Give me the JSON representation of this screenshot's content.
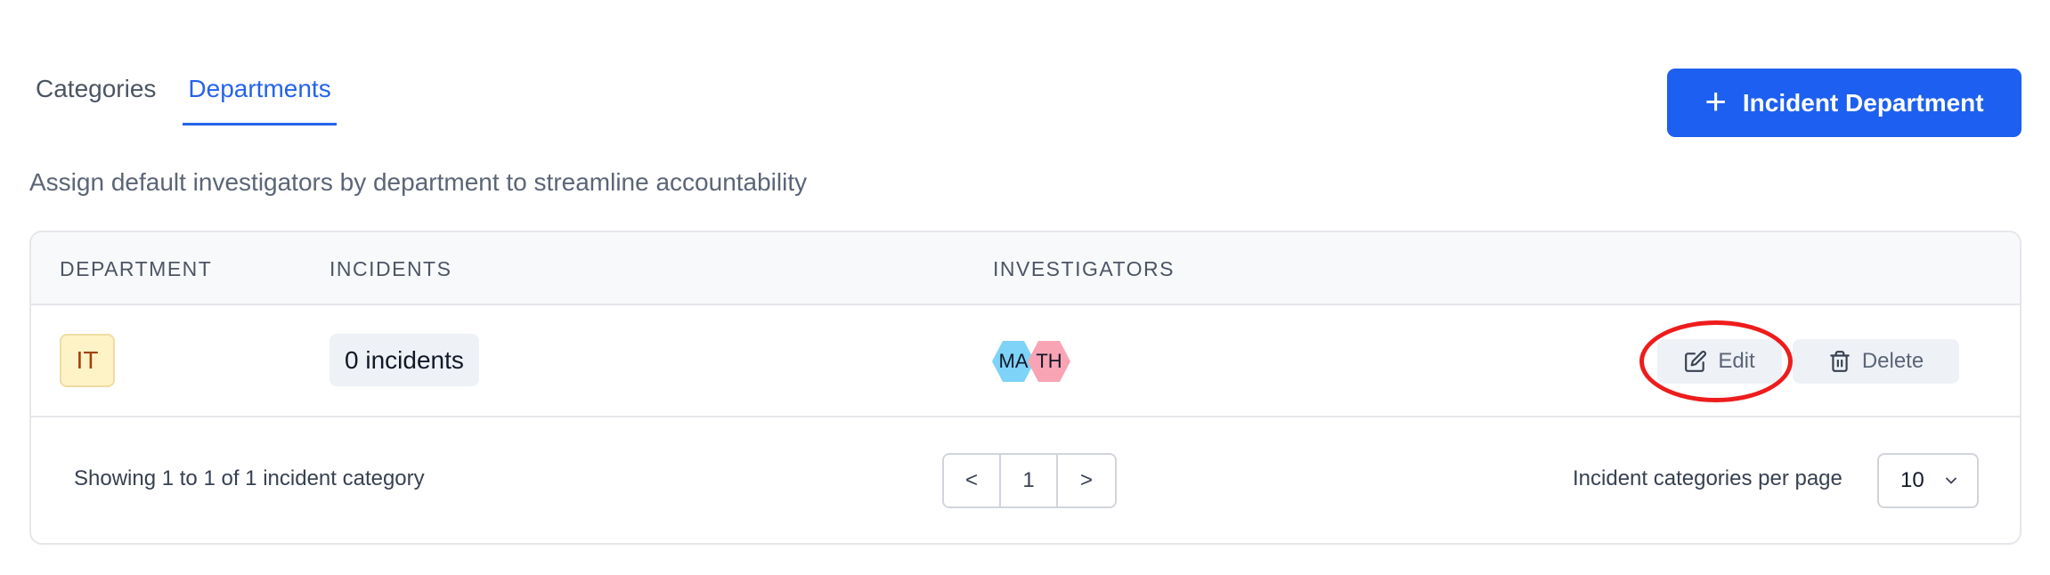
{
  "tabs": [
    {
      "label": "Categories",
      "active": false
    },
    {
      "label": "Departments",
      "active": true
    }
  ],
  "actions": {
    "add_department_label": "Incident Department",
    "add_icon": "plus-icon"
  },
  "subtitle": "Assign default investigators by department to streamline accountability",
  "table": {
    "columns": [
      "DEPARTMENT",
      "INCIDENTS",
      "INVESTIGATORS"
    ],
    "rows": [
      {
        "department": "IT",
        "incidents": "0 incidents",
        "investigators": [
          "MA",
          "TH"
        ],
        "edit_label": "Edit",
        "delete_label": "Delete"
      }
    ]
  },
  "pagination": {
    "showing_prefix": "Showing",
    "from": "1",
    "to_word": "to",
    "to": "1",
    "of_word": "of",
    "total": "1",
    "suffix": "incident category",
    "prev": "<",
    "current_page": "1",
    "next": ">",
    "per_page_label": "Incident categories per page",
    "per_page_value": "10"
  },
  "colors": {
    "primary": "#1d5ff0",
    "active_tab": "#2563eb",
    "highlight": "#ee1c1c",
    "avatar_ma": "#7dd3f8",
    "avatar_th": "#f8a4b4",
    "dept_badge_bg": "#fef3c7"
  }
}
